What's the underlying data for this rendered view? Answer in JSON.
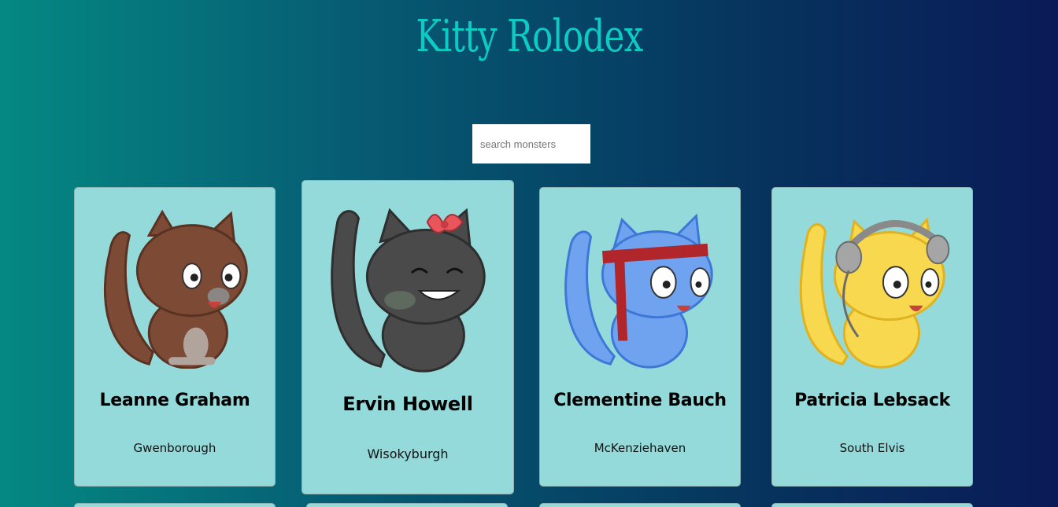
{
  "app": {
    "title": "Kitty Rolodex"
  },
  "search": {
    "placeholder": "search monsters",
    "value": ""
  },
  "cards": [
    {
      "name": "Leanne Graham",
      "city": "Gwenborough",
      "cat": "brown-cat-icon",
      "color": "#7d4a35"
    },
    {
      "name": "Ervin Howell",
      "city": "Wisokyburgh",
      "cat": "gray-cat-with-bow-icon",
      "color": "#4a4a4a"
    },
    {
      "name": "Clementine Bauch",
      "city": "McKenziehaven",
      "cat": "blue-cat-with-headband-icon",
      "color": "#6fa2ef"
    },
    {
      "name": "Patricia Lebsack",
      "city": "South Elvis",
      "cat": "yellow-cat-with-headphones-icon",
      "color": "#f7d84e"
    }
  ],
  "colors": {
    "title": "#0ccac4",
    "card_bg": "#95dada",
    "gradient_start": "#058883",
    "gradient_end": "#0a1a57"
  }
}
